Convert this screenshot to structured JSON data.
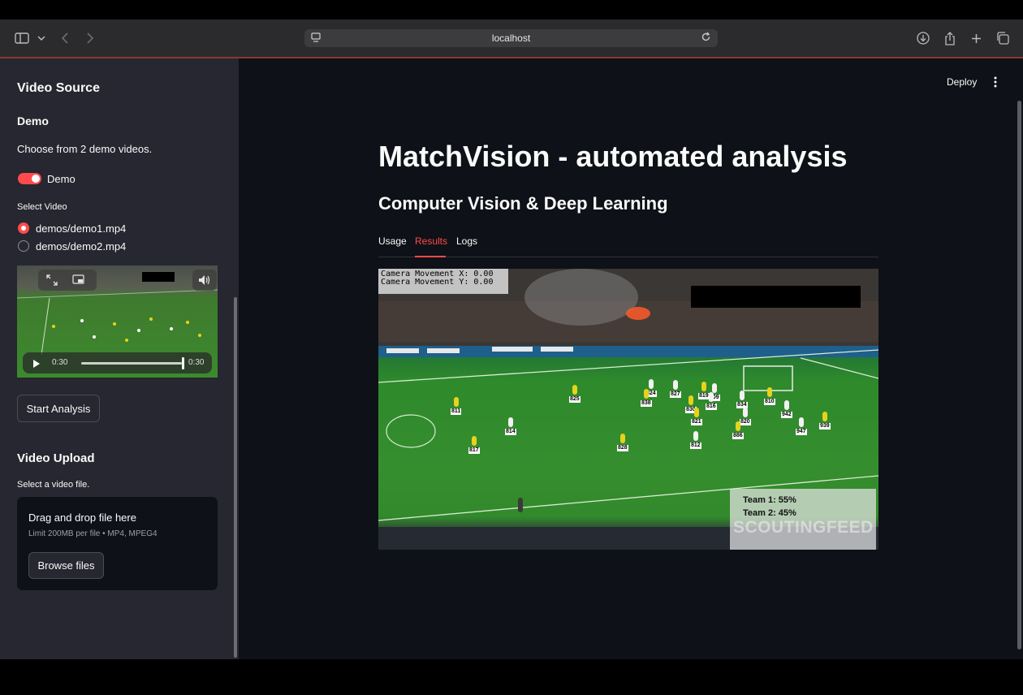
{
  "browser": {
    "url": "localhost"
  },
  "header": {
    "deploy_label": "Deploy"
  },
  "sidebar": {
    "video_source_title": "Video Source",
    "demo_title": "Demo",
    "demo_caption": "Choose from 2 demo videos.",
    "demo_toggle_label": "Demo",
    "demo_toggle_on": true,
    "select_video_label": "Select Video",
    "video_options": [
      "demos/demo1.mp4",
      "demos/demo2.mp4"
    ],
    "selected_video": "demos/demo1.mp4",
    "player": {
      "current_time": "0:30",
      "duration": "0:30",
      "progress": 1.0
    },
    "start_analysis_label": "Start Analysis",
    "upload_title": "Video Upload",
    "upload_caption": "Select a video file.",
    "dropzone_title": "Drag and drop file here",
    "dropzone_limit": "Limit 200MB per file • MP4, MPEG4",
    "browse_label": "Browse files"
  },
  "main": {
    "title": "MatchVision - automated analysis",
    "subtitle": "Computer Vision & Deep Learning",
    "tabs": [
      "Usage",
      "Results",
      "Logs"
    ],
    "active_tab": "Results",
    "result_frame": {
      "camera_x": "Camera Movement X: 0.00",
      "camera_y": "Camera Movement Y: 0.00",
      "team1": "Team 1: 55%",
      "team2": "Team 2: 45%",
      "watermark": "SCOUTINGFEED",
      "player_ids": [
        "825",
        "824",
        "827",
        "819",
        "909",
        "838",
        "816",
        "810",
        "834",
        "830",
        "942",
        "811",
        "821",
        "820",
        "814",
        "947",
        "939",
        "817",
        "828",
        "812",
        "886"
      ]
    }
  },
  "colors": {
    "accent": "#ff4b4b",
    "app_bg": "#0e1117",
    "sidebar_bg": "#262730"
  }
}
